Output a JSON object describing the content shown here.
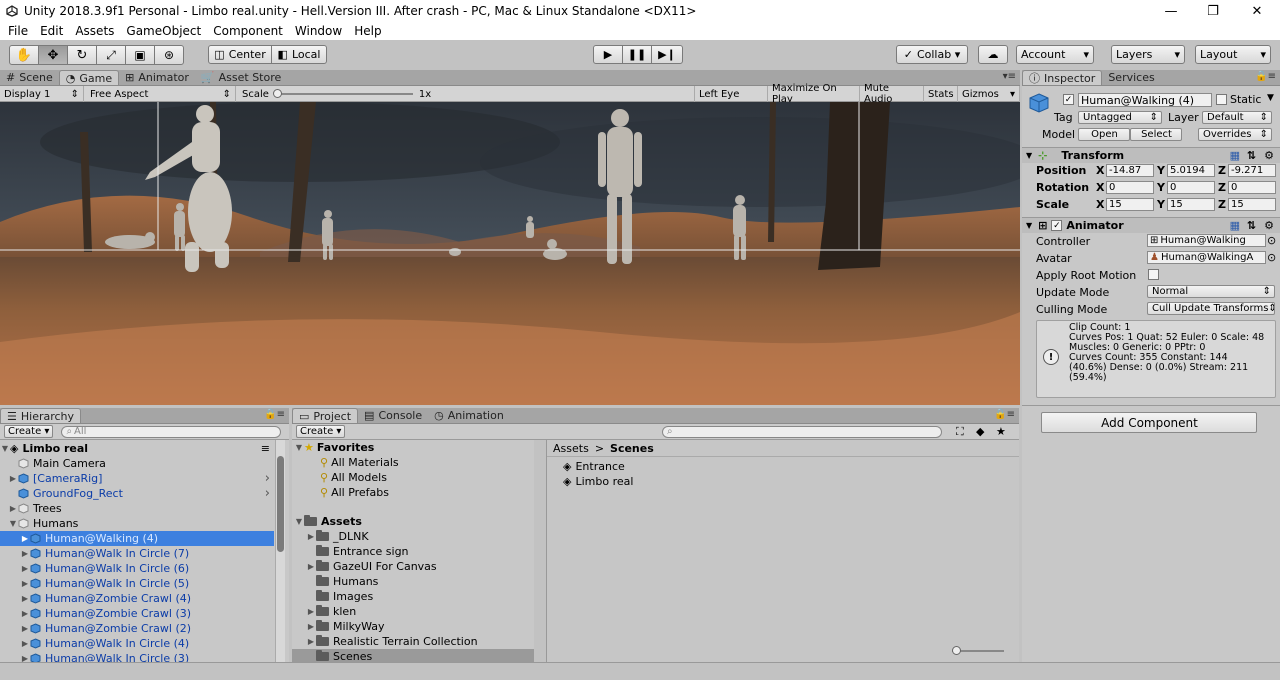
{
  "window": {
    "title": "Unity 2018.3.9f1 Personal - Limbo real.unity - Hell.Version III. After crash - PC, Mac & Linux Standalone <DX11>",
    "min": "—",
    "max": "❐",
    "close": "✕"
  },
  "menu": [
    "File",
    "Edit",
    "Assets",
    "GameObject",
    "Component",
    "Window",
    "Help"
  ],
  "toolbar": {
    "pivot": "Center",
    "space": "Local",
    "collab": "Collab ▾",
    "account": "Account",
    "layers": "Layers",
    "layout": "Layout"
  },
  "top_tabs": {
    "scene": "Scene",
    "game": "Game",
    "animator": "Animator",
    "asset_store": "Asset Store"
  },
  "gamebar": {
    "display": "Display 1",
    "aspect": "Free Aspect",
    "scale_label": "Scale",
    "scale_value": "1x",
    "eye": "Left Eye",
    "maximize": "Maximize On Play",
    "mute": "Mute Audio",
    "stats": "Stats",
    "gizmos": "Gizmos"
  },
  "hierarchy": {
    "tab": "Hierarchy",
    "create": "Create",
    "search_placeholder": "All",
    "scene": "Limbo real",
    "items": [
      {
        "label": "Main Camera",
        "level": 1,
        "arrow": "",
        "style": "normal"
      },
      {
        "label": "[CameraRig]",
        "level": 1,
        "arrow": "▶",
        "style": "blue"
      },
      {
        "label": "GroundFog_Rect",
        "level": 1,
        "arrow": "",
        "style": "blue"
      },
      {
        "label": "Trees",
        "level": 1,
        "arrow": "▶",
        "style": "normal"
      },
      {
        "label": "Humans",
        "level": 1,
        "arrow": "▼",
        "style": "normal"
      },
      {
        "label": "Human@Walking (4)",
        "level": 2,
        "arrow": "▶",
        "style": "selected"
      },
      {
        "label": "Human@Walk In Circle (7)",
        "level": 2,
        "arrow": "▶",
        "style": "blue"
      },
      {
        "label": "Human@Walk In Circle (6)",
        "level": 2,
        "arrow": "▶",
        "style": "blue"
      },
      {
        "label": "Human@Walk In Circle (5)",
        "level": 2,
        "arrow": "▶",
        "style": "blue"
      },
      {
        "label": "Human@Zombie Crawl (4)",
        "level": 2,
        "arrow": "▶",
        "style": "blue"
      },
      {
        "label": "Human@Zombie Crawl (3)",
        "level": 2,
        "arrow": "▶",
        "style": "blue"
      },
      {
        "label": "Human@Zombie Crawl (2)",
        "level": 2,
        "arrow": "▶",
        "style": "blue"
      },
      {
        "label": "Human@Walk In Circle (4)",
        "level": 2,
        "arrow": "▶",
        "style": "blue"
      },
      {
        "label": "Human@Walk In Circle (3)",
        "level": 2,
        "arrow": "▶",
        "style": "blue"
      }
    ]
  },
  "project": {
    "tabs": {
      "project": "Project",
      "console": "Console",
      "animation": "Animation"
    },
    "create": "Create",
    "favorites": "Favorites",
    "favorite_items": [
      "All Materials",
      "All Models",
      "All Prefabs"
    ],
    "assets": "Assets",
    "folders": [
      "_DLNK",
      "Entrance sign",
      "GazeUI For Canvas",
      "Humans",
      "Images",
      "klen",
      "MilkyWay",
      "Realistic Terrain Collection",
      "Scenes"
    ],
    "breadcrumb": {
      "root": "Assets",
      "sep": ">",
      "current": "Scenes"
    },
    "scene_files": [
      "Entrance",
      "Limbo real"
    ]
  },
  "inspector": {
    "tabs": {
      "inspector": "Inspector",
      "services": "Services"
    },
    "object_name": "Human@Walking (4)",
    "static_label": "Static",
    "tag_label": "Tag",
    "tag_value": "Untagged",
    "layer_label": "Layer",
    "layer_value": "Default",
    "model_label": "Model",
    "open": "Open",
    "select": "Select",
    "overrides": "Overrides",
    "transform": {
      "title": "Transform",
      "position_label": "Position",
      "rotation_label": "Rotation",
      "scale_label": "Scale",
      "position": [
        "-14.87",
        "5.0194",
        "-9.271"
      ],
      "rotation": [
        "0",
        "0",
        "0"
      ],
      "scale": [
        "15",
        "15",
        "15"
      ]
    },
    "animator": {
      "title": "Animator",
      "controller_label": "Controller",
      "controller_value": "Human@Walking",
      "avatar_label": "Avatar",
      "avatar_value": "Human@WalkingA",
      "root_motion_label": "Apply Root Motion",
      "update_label": "Update Mode",
      "update_value": "Normal",
      "culling_label": "Culling Mode",
      "culling_value": "Cull Update Transforms",
      "info": [
        "Clip Count: 1",
        "Curves Pos: 1 Quat: 52 Euler: 0 Scale: 48",
        "Muscles: 0 Generic: 0 PPtr: 0",
        "Curves Count: 355 Constant: 144",
        "(40.6%) Dense: 0 (0.0%) Stream: 211",
        "(59.4%)"
      ]
    },
    "add_component": "Add Component"
  },
  "axis": {
    "x": "X",
    "y": "Y",
    "z": "Z"
  }
}
